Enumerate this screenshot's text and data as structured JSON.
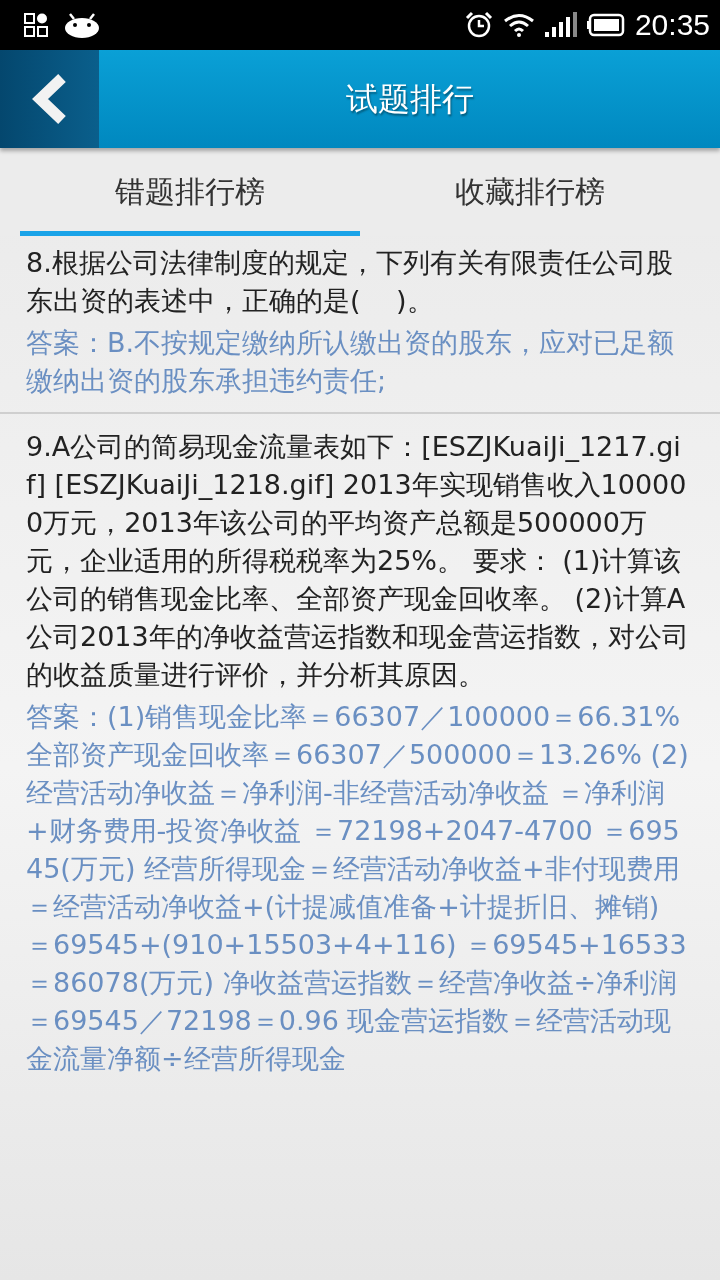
{
  "status_bar": {
    "time": "20:35"
  },
  "header": {
    "title": "试题排行"
  },
  "tabs": [
    {
      "label": "错题排行榜",
      "selected": true
    },
    {
      "label": "收藏排行榜",
      "selected": false
    }
  ],
  "questions": [
    {
      "question": "8.根据公司法律制度的规定，下列有关有限责任公司股东出资的表述中，正确的是(　 )。",
      "answer": "答案：B.不按规定缴纳所认缴出资的股东，应对已足额缴纳出资的股东承担违约责任;"
    },
    {
      "question": "9.A公司的简易现金流量表如下：[ESZJKuaiJi_1217.gif] [ESZJKuaiJi_1218.gif] 2013年实现销售收入100000万元，2013年该公司的平均资产总额是500000万元，企业适用的所得税税率为25%。 要求： (1)计算该公司的销售现金比率、全部资产现金回收率。 (2)计算A公司2013年的净收益营运指数和现金营运指数，对公司的收益质量进行评价，并分析其原因。",
      "answer": "答案：(1)销售现金比率＝66307／100000＝66.31% 全部资产现金回收率＝66307／500000＝13.26% (2)经营活动净收益＝净利润-非经营活动净收益 ＝净利润+财务费用-投资净收益 ＝72198+2047-4700 ＝69545(万元) 经营所得现金＝经营活动净收益+非付现费用＝经营活动净收益+(计提减值准备+计提折旧、摊销) ＝69545+(910+15503+4+116) ＝69545+16533＝86078(万元) 净收益营运指数＝经营净收益÷净利润＝69545／72198＝0.96 现金营运指数＝经营活动现金流量净额÷经营所得现金"
    }
  ]
}
